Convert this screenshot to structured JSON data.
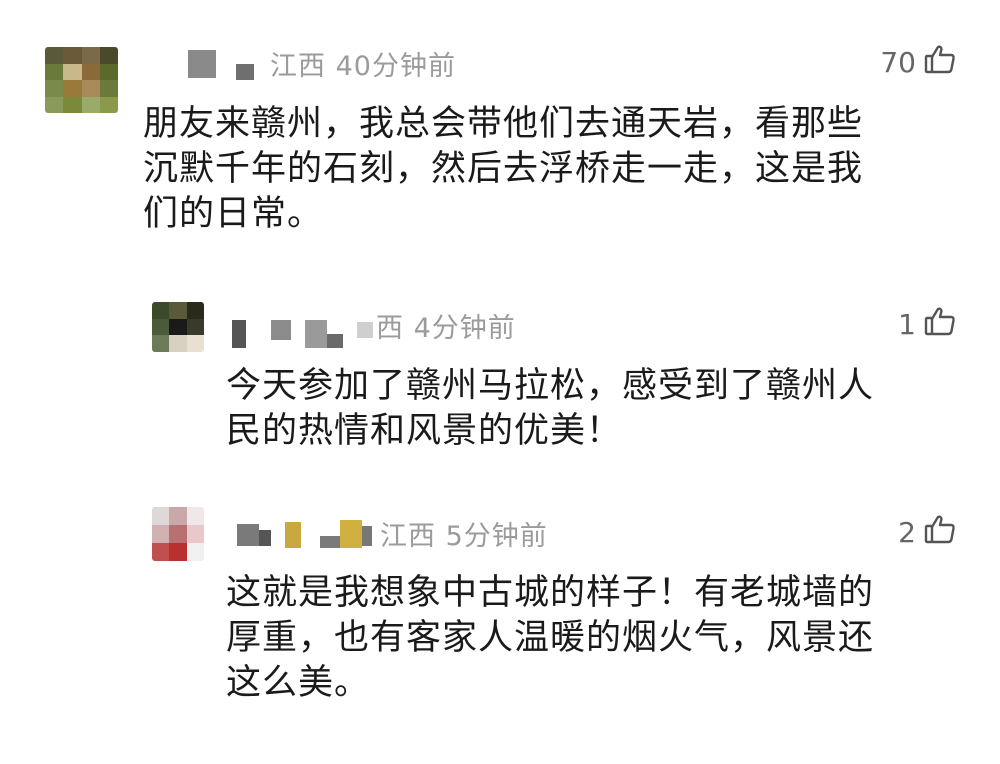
{
  "comments": [
    {
      "location": "江西",
      "time": "40分钟前",
      "likes": "70",
      "text": "朋友来赣州，我总会带他们去通天岩，看那些\n沉默千年的石刻，然后去浮桥走一走，这是我\n们的日常。"
    },
    {
      "location": "西",
      "time": "4分钟前",
      "likes": "1",
      "text": "今天参加了赣州马拉松，感受到了赣州人\n民的热情和风景的优美！"
    },
    {
      "location": "江西",
      "time": "5分钟前",
      "likes": "2",
      "text": "这就是我想象中古城的样子！有老城墙的\n厚重，也有客家人温暖的烟火气，风景还\n这么美。"
    }
  ],
  "colors": {
    "meta": "#9b9b9b",
    "text": "#1a1a1a",
    "likes": "#666666"
  },
  "icons": [
    "thumbs-up-icon"
  ]
}
